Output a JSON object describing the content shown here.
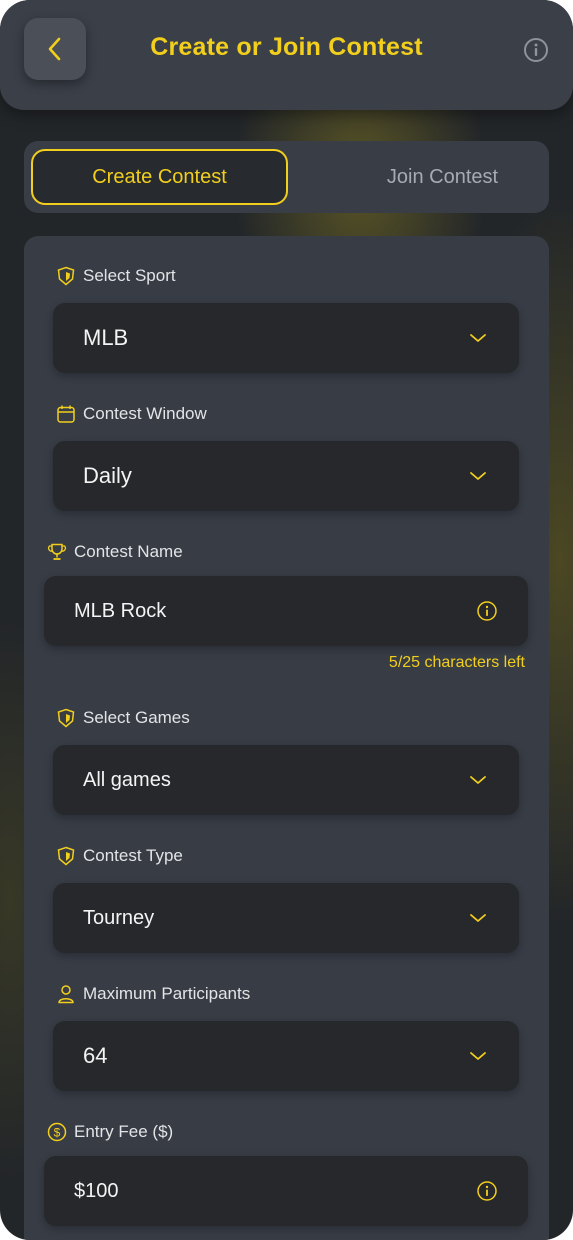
{
  "header": {
    "title": "Create or Join Contest",
    "back_icon": "chevron-left-icon",
    "info_icon": "info-icon"
  },
  "tabs": [
    {
      "label": "Create Contest",
      "active": true
    },
    {
      "label": "Join Contest",
      "active": false
    }
  ],
  "form": {
    "sport": {
      "label": "Select Sport",
      "value": "MLB",
      "icon": "sport-badge-icon"
    },
    "window": {
      "label": "Contest Window",
      "value": "Daily",
      "icon": "calendar-icon"
    },
    "name": {
      "label": "Contest Name",
      "value": "MLB Rock",
      "helper": "5/25 characters left",
      "icon": "trophy-icon"
    },
    "games": {
      "label": "Select Games",
      "value": "All games",
      "icon": "sport-badge-icon"
    },
    "type": {
      "label": "Contest Type",
      "value": "Tourney",
      "icon": "sport-badge-icon"
    },
    "participants": {
      "label": "Maximum Participants",
      "value": "64",
      "icon": "user-icon"
    },
    "fee": {
      "label": "Entry Fee ($)",
      "value": "$100",
      "icon": "dollar-icon"
    }
  },
  "colors": {
    "accent": "#f2cf1c",
    "background": "#232629",
    "card": "#373c45",
    "field": "#26282c"
  }
}
